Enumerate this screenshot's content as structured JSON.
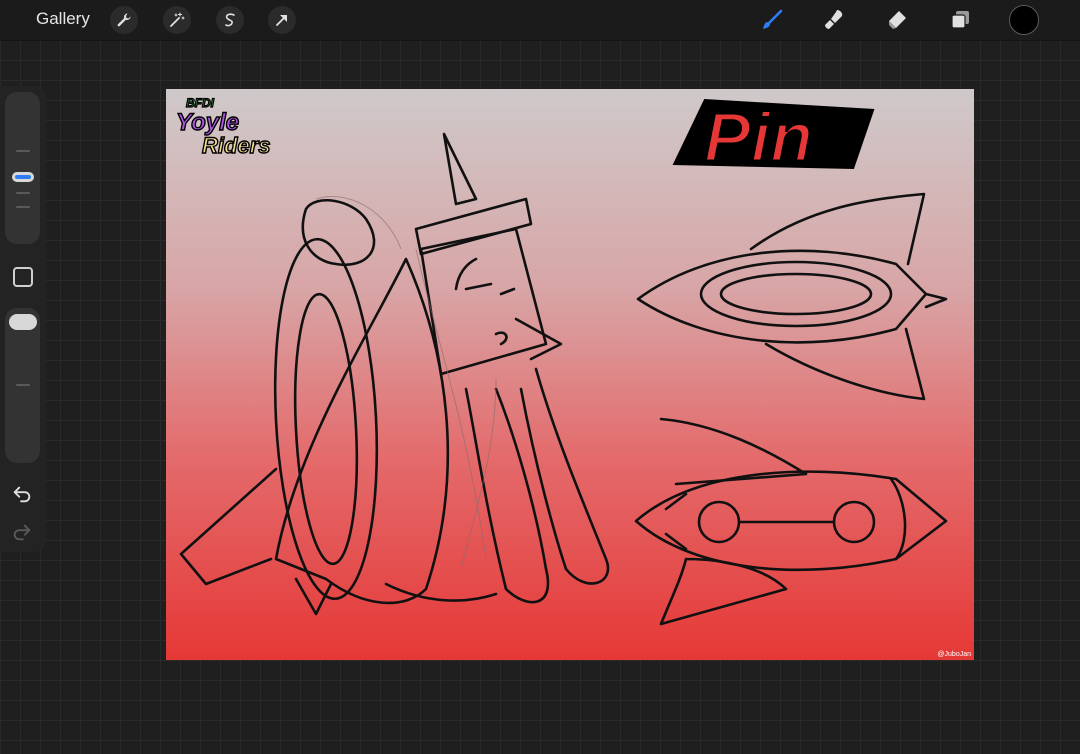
{
  "topbar": {
    "gallery_label": "Gallery",
    "actions": [
      {
        "name": "actions-icon"
      },
      {
        "name": "adjustments-icon"
      },
      {
        "name": "selection-icon"
      },
      {
        "name": "transform-icon"
      }
    ],
    "tools": [
      {
        "name": "brush-icon",
        "active": true
      },
      {
        "name": "smudge-icon",
        "active": false
      },
      {
        "name": "eraser-icon",
        "active": false
      },
      {
        "name": "layers-icon",
        "active": false
      }
    ],
    "current_color": "#000000",
    "active_color": "#2f7df6"
  },
  "sidebar": {
    "brush_size_icon": "size-slider",
    "modify_button_icon": "square-icon",
    "opacity_icon": "opacity-slider",
    "undo_icon": "undo-icon",
    "redo_icon": "redo-icon"
  },
  "canvas": {
    "title": "Pin",
    "logo_lines": [
      "BFDI",
      "Yoyle",
      "Riders"
    ],
    "credit": "@JuboJan",
    "gradient_top": "#cfc9ca",
    "gradient_bottom": "#e53836"
  }
}
